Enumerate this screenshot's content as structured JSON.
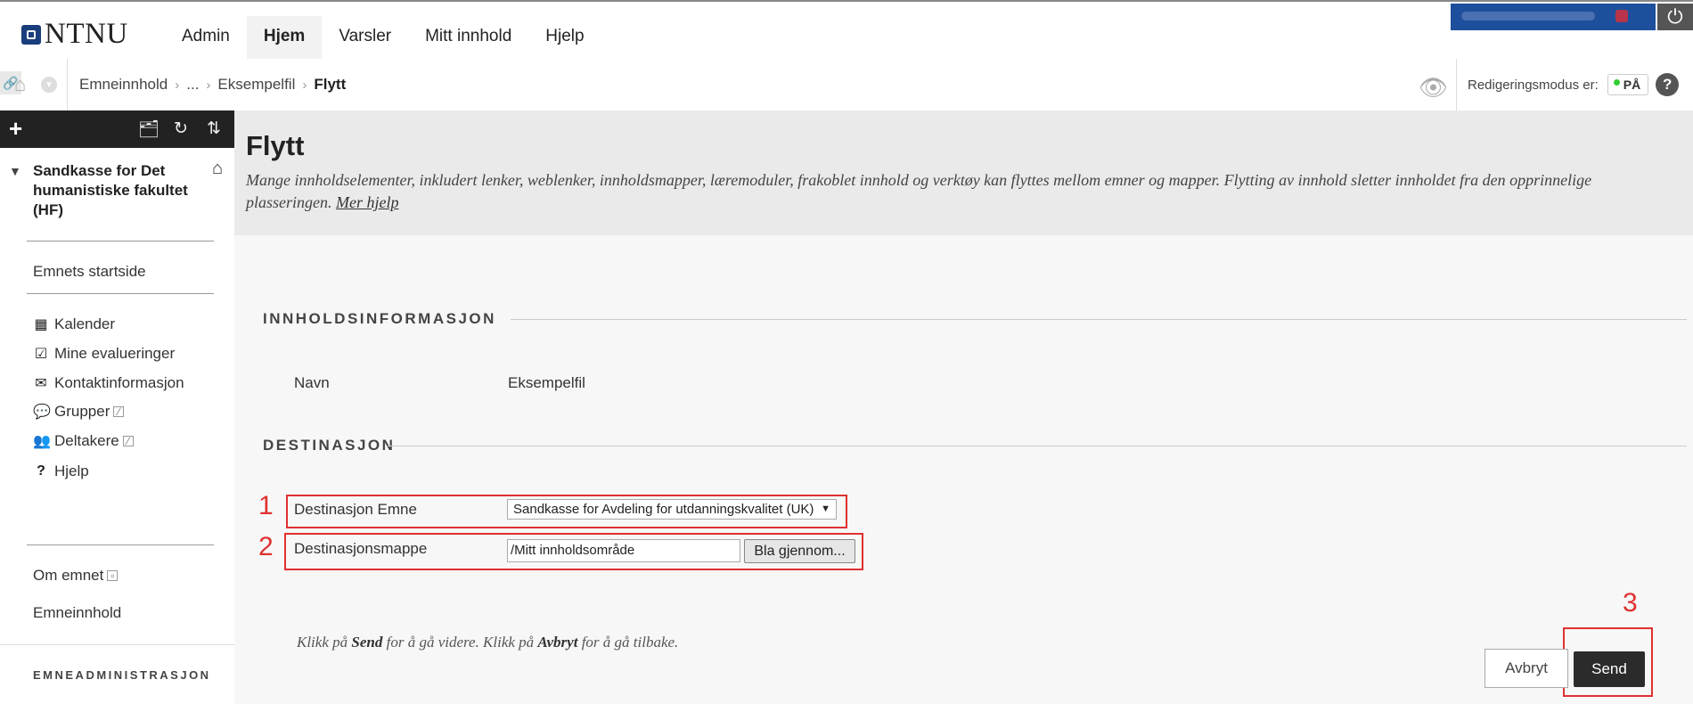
{
  "header": {
    "logo_text": "NTNU",
    "tabs": [
      {
        "label": "Admin"
      },
      {
        "label": "Hjem"
      },
      {
        "label": "Varsler"
      },
      {
        "label": "Mitt innhold"
      },
      {
        "label": "Hjelp"
      }
    ],
    "active_tab": "Hjem"
  },
  "breadcrumb": {
    "items": [
      "Emneinnhold",
      "...",
      "Eksempelfil"
    ],
    "current": "Flytt"
  },
  "edit_mode": {
    "label": "Redigeringsmodus er:",
    "value": "PÅ",
    "indicator_color": "#33cc33"
  },
  "sidebar": {
    "course_title": "Sandkasse for Det humanistiske fakultet (HF)",
    "start_page": "Emnets startside",
    "tools": [
      {
        "label": "Kalender",
        "icon": "calendar-icon"
      },
      {
        "label": "Mine evalueringer",
        "icon": "checkbox-icon"
      },
      {
        "label": "Kontaktinformasjon",
        "icon": "envelope-icon"
      },
      {
        "label": "Grupper",
        "icon": "chat-bubbles-icon"
      },
      {
        "label": "Deltakere",
        "icon": "people-icon"
      },
      {
        "label": "Hjelp",
        "icon": "question-icon"
      }
    ],
    "about": "Om emnet",
    "content": "Emneinnhold",
    "admin_heading": "EMNEADMINISTRASJON"
  },
  "main": {
    "title": "Flytt",
    "description": "Mange innholdselementer, inkludert lenker, weblenker, innholdsmapper, læremoduler, frakoblet innhold og verktøy kan flyttes mellom emner og mapper. Flytting av innhold sletter innholdet fra den opprinnelige plasseringen.",
    "more_help": "Mer hjelp",
    "section_info": "INNHOLDSINFORMASJON",
    "name_label": "Navn",
    "name_value": "Eksempelfil",
    "section_dest": "DESTINASJON",
    "dest_course_label": "Destinasjon Emne",
    "dest_course_value": "Sandkasse for Avdeling for utdanningskvalitet (UK)",
    "dest_folder_label": "Destinasjonsmappe",
    "dest_folder_value": "/Mitt innholdsområde",
    "browse_label": "Bla gjennom...",
    "instructions": {
      "p1": "Klikk på ",
      "send": "Send",
      "p2": " for å gå videre. Klikk på ",
      "cancel": "Avbryt",
      "p3": " for å gå tilbake."
    },
    "cancel_label": "Avbryt",
    "send_label": "Send",
    "annotations": [
      "1",
      "2",
      "3"
    ],
    "annotation_color": "#e03030"
  }
}
